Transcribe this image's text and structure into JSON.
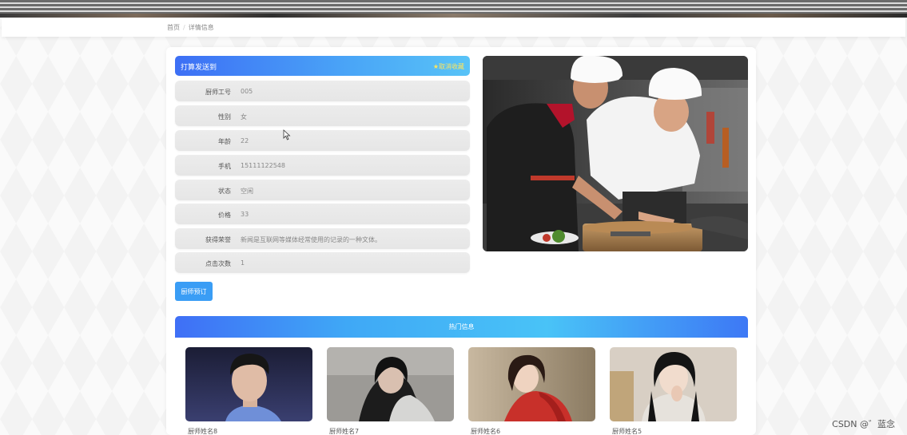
{
  "breadcrumb": {
    "home": "首页",
    "current": "详情信息"
  },
  "detail": {
    "title": "打算发送到",
    "favorite_label": "★取消收藏",
    "fields": [
      {
        "label": "厨师工号",
        "value": "005"
      },
      {
        "label": "性别",
        "value": "女"
      },
      {
        "label": "年龄",
        "value": "22"
      },
      {
        "label": "手机",
        "value": "15111122548"
      },
      {
        "label": "状态",
        "value": "空闲"
      },
      {
        "label": "价格",
        "value": "33"
      },
      {
        "label": "获得荣誉",
        "value": "新闻是互联网等媒体经常使用的记录的一种文体。"
      },
      {
        "label": "点击次数",
        "value": "1"
      }
    ],
    "book_button": "厨师预订"
  },
  "hot": {
    "title": "热门信息",
    "items": [
      {
        "name": "厨师姓名8"
      },
      {
        "name": "厨师姓名7"
      },
      {
        "name": "厨师姓名6"
      },
      {
        "name": "厨师姓名5"
      }
    ]
  },
  "watermark": "CSDN @゛蓝念",
  "colors": {
    "accent": "#3a9df5",
    "header_gradient_start": "#3d6ff5",
    "header_gradient_end": "#58c3f7"
  }
}
